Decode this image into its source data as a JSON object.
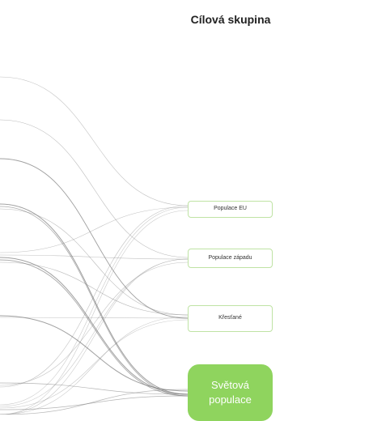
{
  "title": "Cílová skupina",
  "nodes": [
    {
      "id": "eu",
      "label": "Populace EU"
    },
    {
      "id": "west",
      "label": "Populace západu"
    },
    {
      "id": "christians",
      "label": "Křesťané"
    },
    {
      "id": "world",
      "label": "Světová populace"
    }
  ],
  "colors": {
    "accent": "#8fd45e",
    "node_border": "#bfe3a4",
    "link": "#777777"
  }
}
